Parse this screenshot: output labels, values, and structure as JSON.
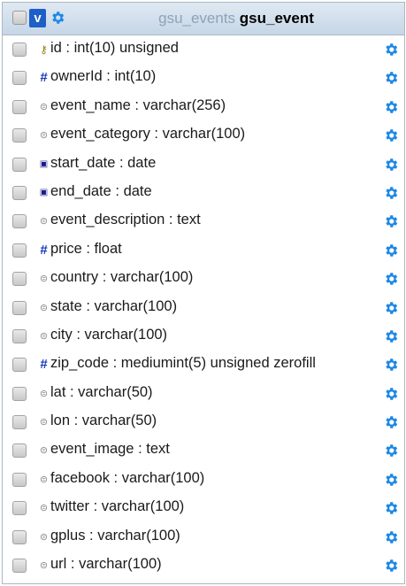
{
  "header": {
    "toggle_label": "v",
    "database": "gsu_events",
    "table": "gsu_event"
  },
  "columns": [
    {
      "label": "id : int(10) unsigned",
      "icon": "key-icon"
    },
    {
      "label": "ownerId : int(10)",
      "icon": "numeric-icon"
    },
    {
      "label": "event_name : varchar(256)",
      "icon": "text-icon"
    },
    {
      "label": "event_category : varchar(100)",
      "icon": "text-icon"
    },
    {
      "label": "start_date : date",
      "icon": "date-icon"
    },
    {
      "label": "end_date : date",
      "icon": "date-icon"
    },
    {
      "label": "event_description : text",
      "icon": "text-icon"
    },
    {
      "label": "price : float",
      "icon": "numeric-icon"
    },
    {
      "label": "country : varchar(100)",
      "icon": "text-icon"
    },
    {
      "label": "state : varchar(100)",
      "icon": "text-icon"
    },
    {
      "label": "city : varchar(100)",
      "icon": "text-icon"
    },
    {
      "label": "zip_code : mediumint(5) unsigned zerofill",
      "icon": "numeric-icon"
    },
    {
      "label": "lat : varchar(50)",
      "icon": "text-icon"
    },
    {
      "label": "lon : varchar(50)",
      "icon": "text-icon"
    },
    {
      "label": "event_image : text",
      "icon": "text-icon"
    },
    {
      "label": "facebook : varchar(100)",
      "icon": "text-icon"
    },
    {
      "label": "twitter : varchar(100)",
      "icon": "text-icon"
    },
    {
      "label": "gplus : varchar(100)",
      "icon": "text-icon"
    },
    {
      "label": "url : varchar(100)",
      "icon": "text-icon"
    }
  ],
  "colors": {
    "header_bg": "#c6d6e6",
    "toggle_bg": "#1d5fc9",
    "gear": "#1e88e5",
    "db_name": "#8fa2b8"
  }
}
